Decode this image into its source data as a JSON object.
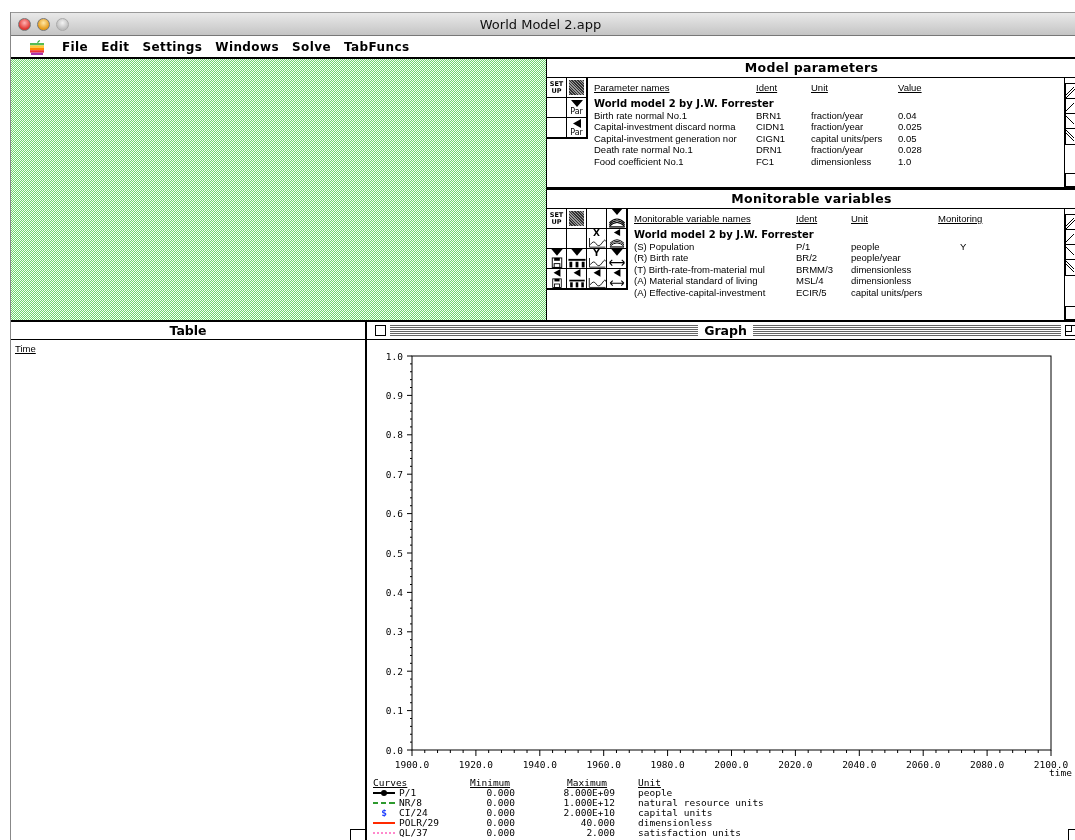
{
  "window": {
    "title": "World Model 2.app"
  },
  "menu": [
    "File",
    "Edit",
    "Settings",
    "Windows",
    "Solve",
    "TabFuncs"
  ],
  "parameters": {
    "title": "Model parameters",
    "tools": [
      {
        "kind": "setup",
        "label": "SET UP"
      },
      {
        "kind": "pattern"
      },
      {
        "kind": "blank"
      },
      {
        "kind": "par-down",
        "label": "Par"
      },
      {
        "kind": "blank"
      },
      {
        "kind": "par-left",
        "label": "Par"
      }
    ],
    "columns": [
      "Parameter names",
      "Ident",
      "Unit",
      "Value"
    ],
    "group": "World model 2 by J.W. Forrester",
    "rows": [
      {
        "name": "Birth rate normal No.1",
        "ident": "BRN1",
        "unit": "fraction/year",
        "value": "0.04"
      },
      {
        "name": "Capital-investment discard norma",
        "ident": "CIDN1",
        "unit": "fraction/year",
        "value": "0.025"
      },
      {
        "name": "Capital-investment generation nor",
        "ident": "CIGN1",
        "unit": "capital units/pers",
        "value": "0.05"
      },
      {
        "name": "Death rate normal No.1",
        "ident": "DRN1",
        "unit": "fraction/year",
        "value": "0.028"
      },
      {
        "name": "Food coefficient No.1",
        "ident": "FC1",
        "unit": "dimensionless",
        "value": "1.0"
      }
    ]
  },
  "monitor": {
    "title": "Monitorable variables",
    "tools": [
      {
        "kind": "setup",
        "label": "SET UP"
      },
      {
        "kind": "pattern"
      },
      {
        "kind": "blank"
      },
      {
        "kind": "stack-down"
      },
      {
        "kind": "blank"
      },
      {
        "kind": "blank"
      },
      {
        "kind": "graph",
        "label": "X"
      },
      {
        "kind": "stack-left"
      },
      {
        "kind": "disk-down"
      },
      {
        "kind": "bars-down"
      },
      {
        "kind": "graph",
        "label": "Y"
      },
      {
        "kind": "span-down"
      },
      {
        "kind": "disk-left"
      },
      {
        "kind": "bars-left"
      },
      {
        "kind": "graph-left"
      },
      {
        "kind": "span-left"
      }
    ],
    "columns": [
      "Monitorable variable names",
      "Ident",
      "Unit",
      "Monitoring"
    ],
    "group": "World model 2 by J.W. Forrester",
    "rows": [
      {
        "name": "(S) Population",
        "ident": "P/1",
        "unit": "people",
        "value": "Y"
      },
      {
        "name": "(R) Birth rate",
        "ident": "BR/2",
        "unit": "people/year"
      },
      {
        "name": "(T) Birth-rate-from-material mul",
        "ident": "BRMM/3",
        "unit": "dimensionless"
      },
      {
        "name": "(A) Material standard of living",
        "ident": "MSL/4",
        "unit": "dimensionless"
      },
      {
        "name": "(A) Effective-capital-investment",
        "ident": "ECIR/5",
        "unit": "capital units/pers"
      }
    ]
  },
  "table": {
    "title": "Table",
    "columns": [
      "Time"
    ]
  },
  "graph": {
    "title": "Graph",
    "chart_data": {
      "type": "line",
      "xlabel": "time",
      "xlim": [
        1900,
        2100
      ],
      "ylim": [
        0,
        1
      ],
      "xticks": [
        {
          "value": 1900,
          "label": "1900.0"
        },
        {
          "value": 1920,
          "label": "1920.0"
        },
        {
          "value": 1940,
          "label": "1940.0"
        },
        {
          "value": 1960,
          "label": "1960.0"
        },
        {
          "value": 1980,
          "label": "1980.0"
        },
        {
          "value": 2000,
          "label": "2000.0"
        },
        {
          "value": 2020,
          "label": "2020.0"
        },
        {
          "value": 2040,
          "label": "2040.0"
        },
        {
          "value": 2060,
          "label": "2060.0"
        },
        {
          "value": 2080,
          "label": "2080.0"
        },
        {
          "value": 2100,
          "label": "2100.0"
        }
      ],
      "yticks": [
        {
          "value": 0,
          "label": "0.0"
        },
        {
          "value": 0.1,
          "label": "0.1"
        },
        {
          "value": 0.2,
          "label": "0.2"
        },
        {
          "value": 0.3,
          "label": "0.3"
        },
        {
          "value": 0.4,
          "label": "0.4"
        },
        {
          "value": 0.5,
          "label": "0.5"
        },
        {
          "value": 0.6,
          "label": "0.6"
        },
        {
          "value": 0.7,
          "label": "0.7"
        },
        {
          "value": 0.8,
          "label": "0.8"
        },
        {
          "value": 0.9,
          "label": "0.9"
        },
        {
          "value": 1,
          "label": "1.0"
        }
      ]
    },
    "legend_columns": [
      "Curves",
      "Minimum",
      "Maximum",
      "Unit"
    ],
    "curves": [
      {
        "kind": "dot-line",
        "color": "#000000",
        "name": "P/1",
        "minimum": "0.000",
        "maximum": "8.000E+09",
        "unit": "people"
      },
      {
        "kind": "dashed",
        "color": "#2e9a2e",
        "name": "NR/8",
        "minimum": "0.000",
        "maximum": "1.000E+12",
        "unit": "natural resource units"
      },
      {
        "kind": "symbol",
        "symbol": "$",
        "color": "#1f3fff",
        "name": "CI/24",
        "minimum": "0.000",
        "maximum": "2.000E+10",
        "unit": "capital units"
      },
      {
        "kind": "line",
        "color": "#ff2a00",
        "name": "POLR/29",
        "minimum": "0.000",
        "maximum": "40.000",
        "unit": "dimensionless"
      },
      {
        "kind": "dotted",
        "color": "#ff88cc",
        "name": "QL/37",
        "minimum": "0.000",
        "maximum": "2.000",
        "unit": "satisfaction units"
      }
    ]
  }
}
